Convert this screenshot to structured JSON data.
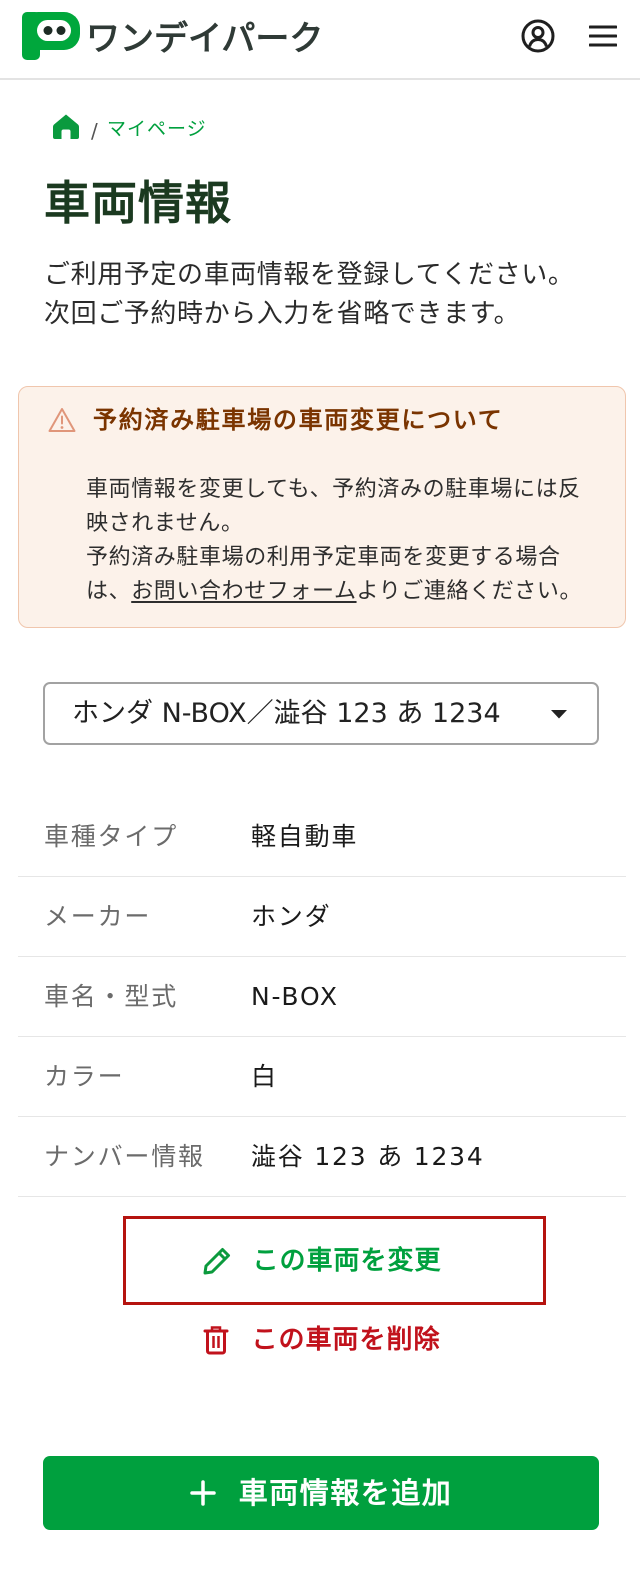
{
  "header": {
    "logo_text": "ワンデイパーク",
    "logo_icon": "parking-p-logo-icon",
    "account_icon": "user-circle-icon",
    "menu_icon": "hamburger-menu-icon"
  },
  "breadcrumb": {
    "home_icon": "home-icon",
    "separator": "/",
    "current": "マイページ"
  },
  "page": {
    "title": "車両情報",
    "description_line1": "ご利用予定の車両情報を登録してください。",
    "description_line2": "次回ご予約時から入力を省略できます。"
  },
  "notice": {
    "icon": "warning-icon",
    "title": "予約済み駐車場の車両変更について",
    "paragraph1": "車両情報を変更しても、予約済みの駐車場には反映されません。",
    "paragraph2_before": "予約済み駐車場の利用予定車両を変更する場合は、",
    "paragraph2_link": "お問い合わせフォーム",
    "paragraph2_after": "よりご連絡ください。"
  },
  "vehicle_select": {
    "selected": "ホンダ N-BOX／澁谷 123 あ 1234",
    "icon": "caret-down-icon"
  },
  "vehicle_info": {
    "rows": [
      {
        "label": "車種タイプ",
        "value": "軽自動車"
      },
      {
        "label": "メーカー",
        "value": "ホンダ"
      },
      {
        "label": "車名・型式",
        "value": "N-BOX"
      },
      {
        "label": "カラー",
        "value": "白"
      },
      {
        "label": "ナンバー情報",
        "value": "澁谷 123 あ 1234"
      }
    ]
  },
  "actions": {
    "edit_label": "この車両を変更",
    "edit_icon": "pencil-icon",
    "delete_label": "この車両を削除",
    "delete_icon": "trash-icon",
    "add_label": "車両情報を追加",
    "add_icon": "plus-icon"
  },
  "theme": {
    "brand_green": "#00a03e",
    "title_color": "#1b3a20",
    "danger_red": "#c1121c",
    "notice_background": "#fcf2ea",
    "notice_border": "#f0c6ad",
    "notice_title_color": "#7a3400",
    "highlight_border": "#b5130f"
  }
}
